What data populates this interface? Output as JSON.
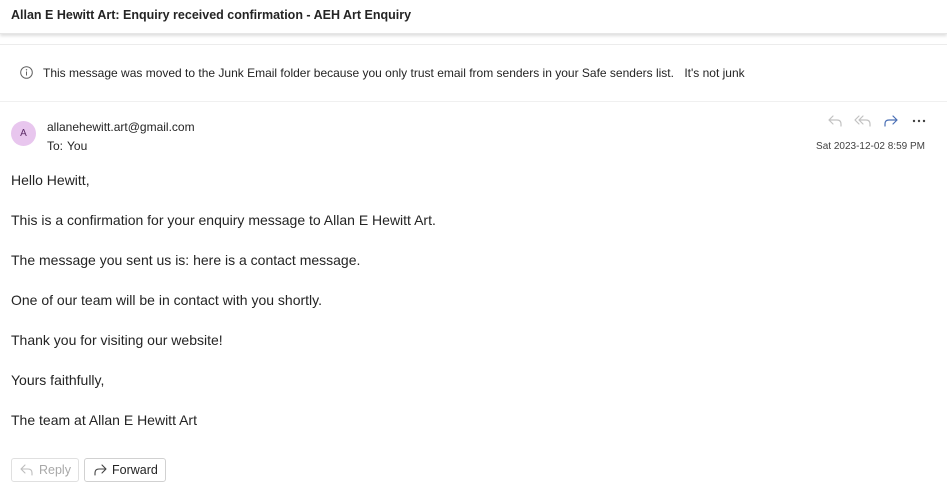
{
  "subject": "Allan E Hewitt Art: Enquiry received confirmation - AEH Art Enquiry",
  "junk_banner": {
    "message": "This message was moved to the Junk Email folder because you only trust email from senders in your Safe senders list.",
    "not_junk_label": "It's not junk"
  },
  "email": {
    "avatar_initial": "A",
    "avatar_color": "#e8c6ee",
    "sender": "allanehewitt.art@gmail.com",
    "to_label": "To:",
    "to_value": "You",
    "date": "Sat 2023-12-02 8:59 PM",
    "actions": [
      "reply-icon",
      "reply-all-icon",
      "forward-icon",
      "more-icon"
    ],
    "body": [
      "Hello Hewitt,",
      "This is a confirmation for your enquiry message to Allan E Hewitt Art.",
      "The message you sent us is: here is a contact message.",
      "One of our team will be in contact with you shortly.",
      "Thank you for visiting our website!",
      "Yours faithfully,",
      "The team at Allan E Hewitt Art"
    ]
  },
  "footer": {
    "reply_label": "Reply",
    "forward_label": "Forward"
  }
}
